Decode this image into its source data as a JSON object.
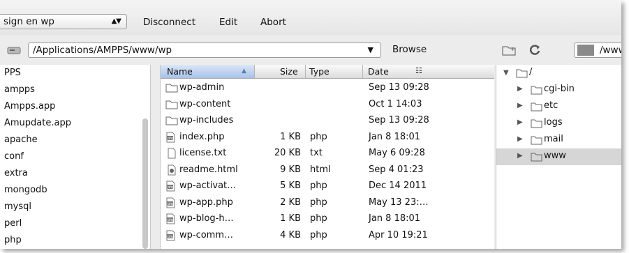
{
  "toolbar": {
    "site": "sign en wp",
    "menu": [
      "Disconnect",
      "Edit",
      "Abort"
    ]
  },
  "local": {
    "path": "/Applications/AMPPS/www/wp",
    "browse_label": "Browse",
    "tree": [
      "PPS",
      "ampps",
      "Ampps.app",
      "Amupdate.app",
      "apache",
      "conf",
      "extra",
      "mongodb",
      "mysql",
      "perl",
      "php"
    ]
  },
  "filelist": {
    "columns": {
      "name": "Name",
      "size": "Size",
      "type": "Type",
      "date": "Date"
    },
    "rows": [
      {
        "icon": "folder-icon",
        "name": "wp-admin",
        "size": "",
        "type": "",
        "date": "Sep 13 09:28"
      },
      {
        "icon": "folder-icon",
        "name": "wp-content",
        "size": "",
        "type": "",
        "date": "Oct 1 14:03"
      },
      {
        "icon": "folder-icon",
        "name": "wp-includes",
        "size": "",
        "type": "",
        "date": "Sep 13 09:28"
      },
      {
        "icon": "php-file-icon",
        "name": "index.php",
        "size": "1 KB",
        "type": "php",
        "date": "Jan 8 18:01"
      },
      {
        "icon": "text-file-icon",
        "name": "license.txt",
        "size": "20 KB",
        "type": "txt",
        "date": "May 6 09:28"
      },
      {
        "icon": "html-file-icon",
        "name": "readme.html",
        "size": "9 KB",
        "type": "html",
        "date": "Sep 4 01:23"
      },
      {
        "icon": "php-file-icon",
        "name": "wp-activat…",
        "size": "5 KB",
        "type": "php",
        "date": "Dec 14 2011"
      },
      {
        "icon": "php-file-icon",
        "name": "wp-app.php",
        "size": "2 KB",
        "type": "php",
        "date": "May 13 23:…"
      },
      {
        "icon": "php-file-icon",
        "name": "wp-blog-h…",
        "size": "1 KB",
        "type": "php",
        "date": "Jan 8 18:01"
      },
      {
        "icon": "php-file-icon",
        "name": "wp-comm…",
        "size": "4 KB",
        "type": "php",
        "date": "Apr 10 19:21"
      }
    ]
  },
  "remote": {
    "path": "/www",
    "root": "/",
    "tree": [
      "cgi-bin",
      "etc",
      "logs",
      "mail",
      "www"
    ],
    "selected": "www"
  }
}
